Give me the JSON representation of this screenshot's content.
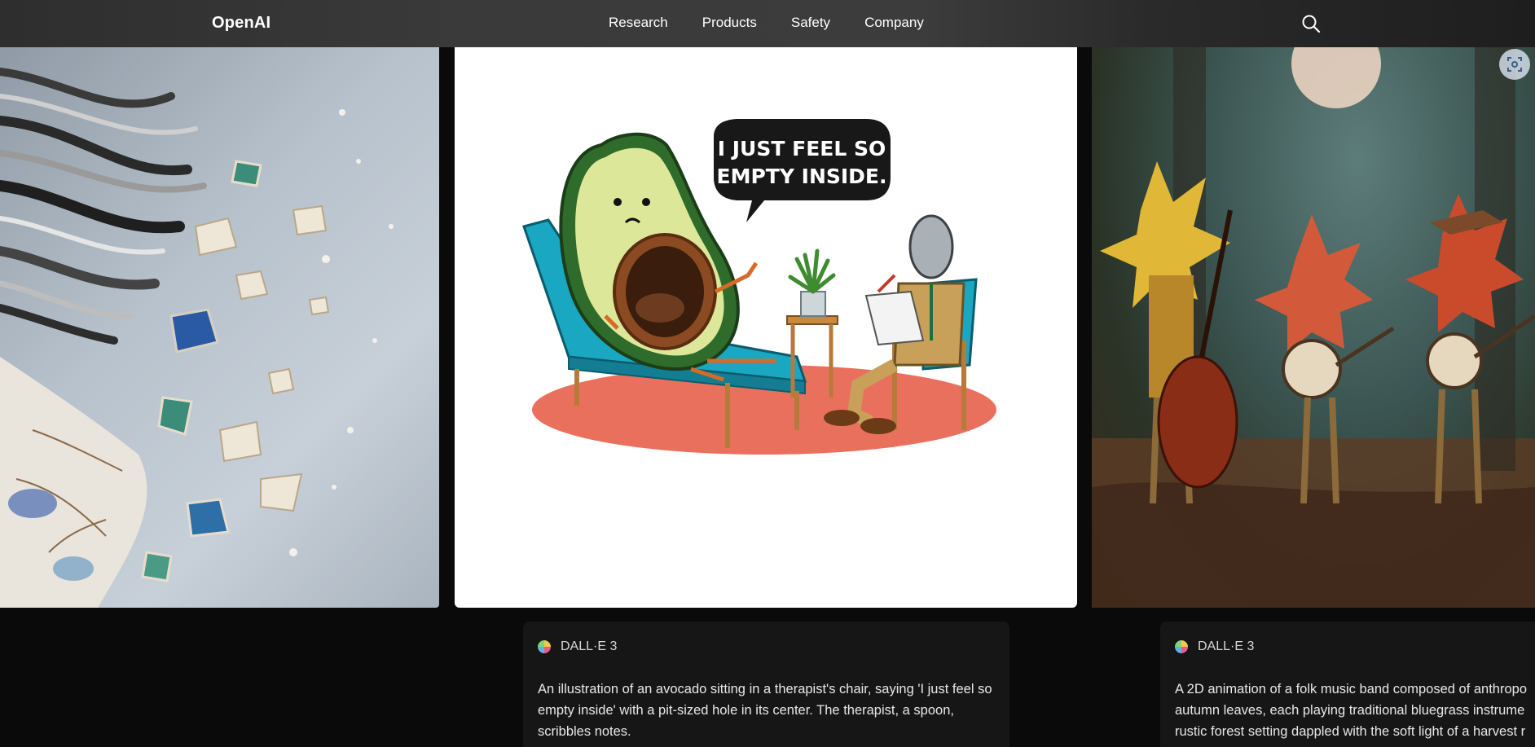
{
  "nav": {
    "logo": "OpenAI",
    "links": [
      "Research",
      "Products",
      "Safety",
      "Company"
    ],
    "search_icon": "search-icon"
  },
  "gallery": {
    "center_illustration": {
      "speech_bubble": "I JUST FEEL SO EMPTY INSIDE."
    }
  },
  "captions": [
    {
      "model": "DALL·E 3",
      "text": "An illustration of an avocado sitting in a therapist's chair, saying 'I just feel so empty inside' with a pit-sized hole in its center. The therapist, a spoon, scribbles notes."
    },
    {
      "model": "DALL·E 3",
      "text_lines": [
        "A 2D animation of a folk music band composed of anthropo",
        "autumn leaves, each playing traditional bluegrass instrume",
        "rustic forest setting dappled with the soft light of a harvest r"
      ]
    }
  ],
  "colors": {
    "nav_bg": "#383838",
    "page_bg": "#0a0a0a",
    "card_bg": "#161616"
  }
}
